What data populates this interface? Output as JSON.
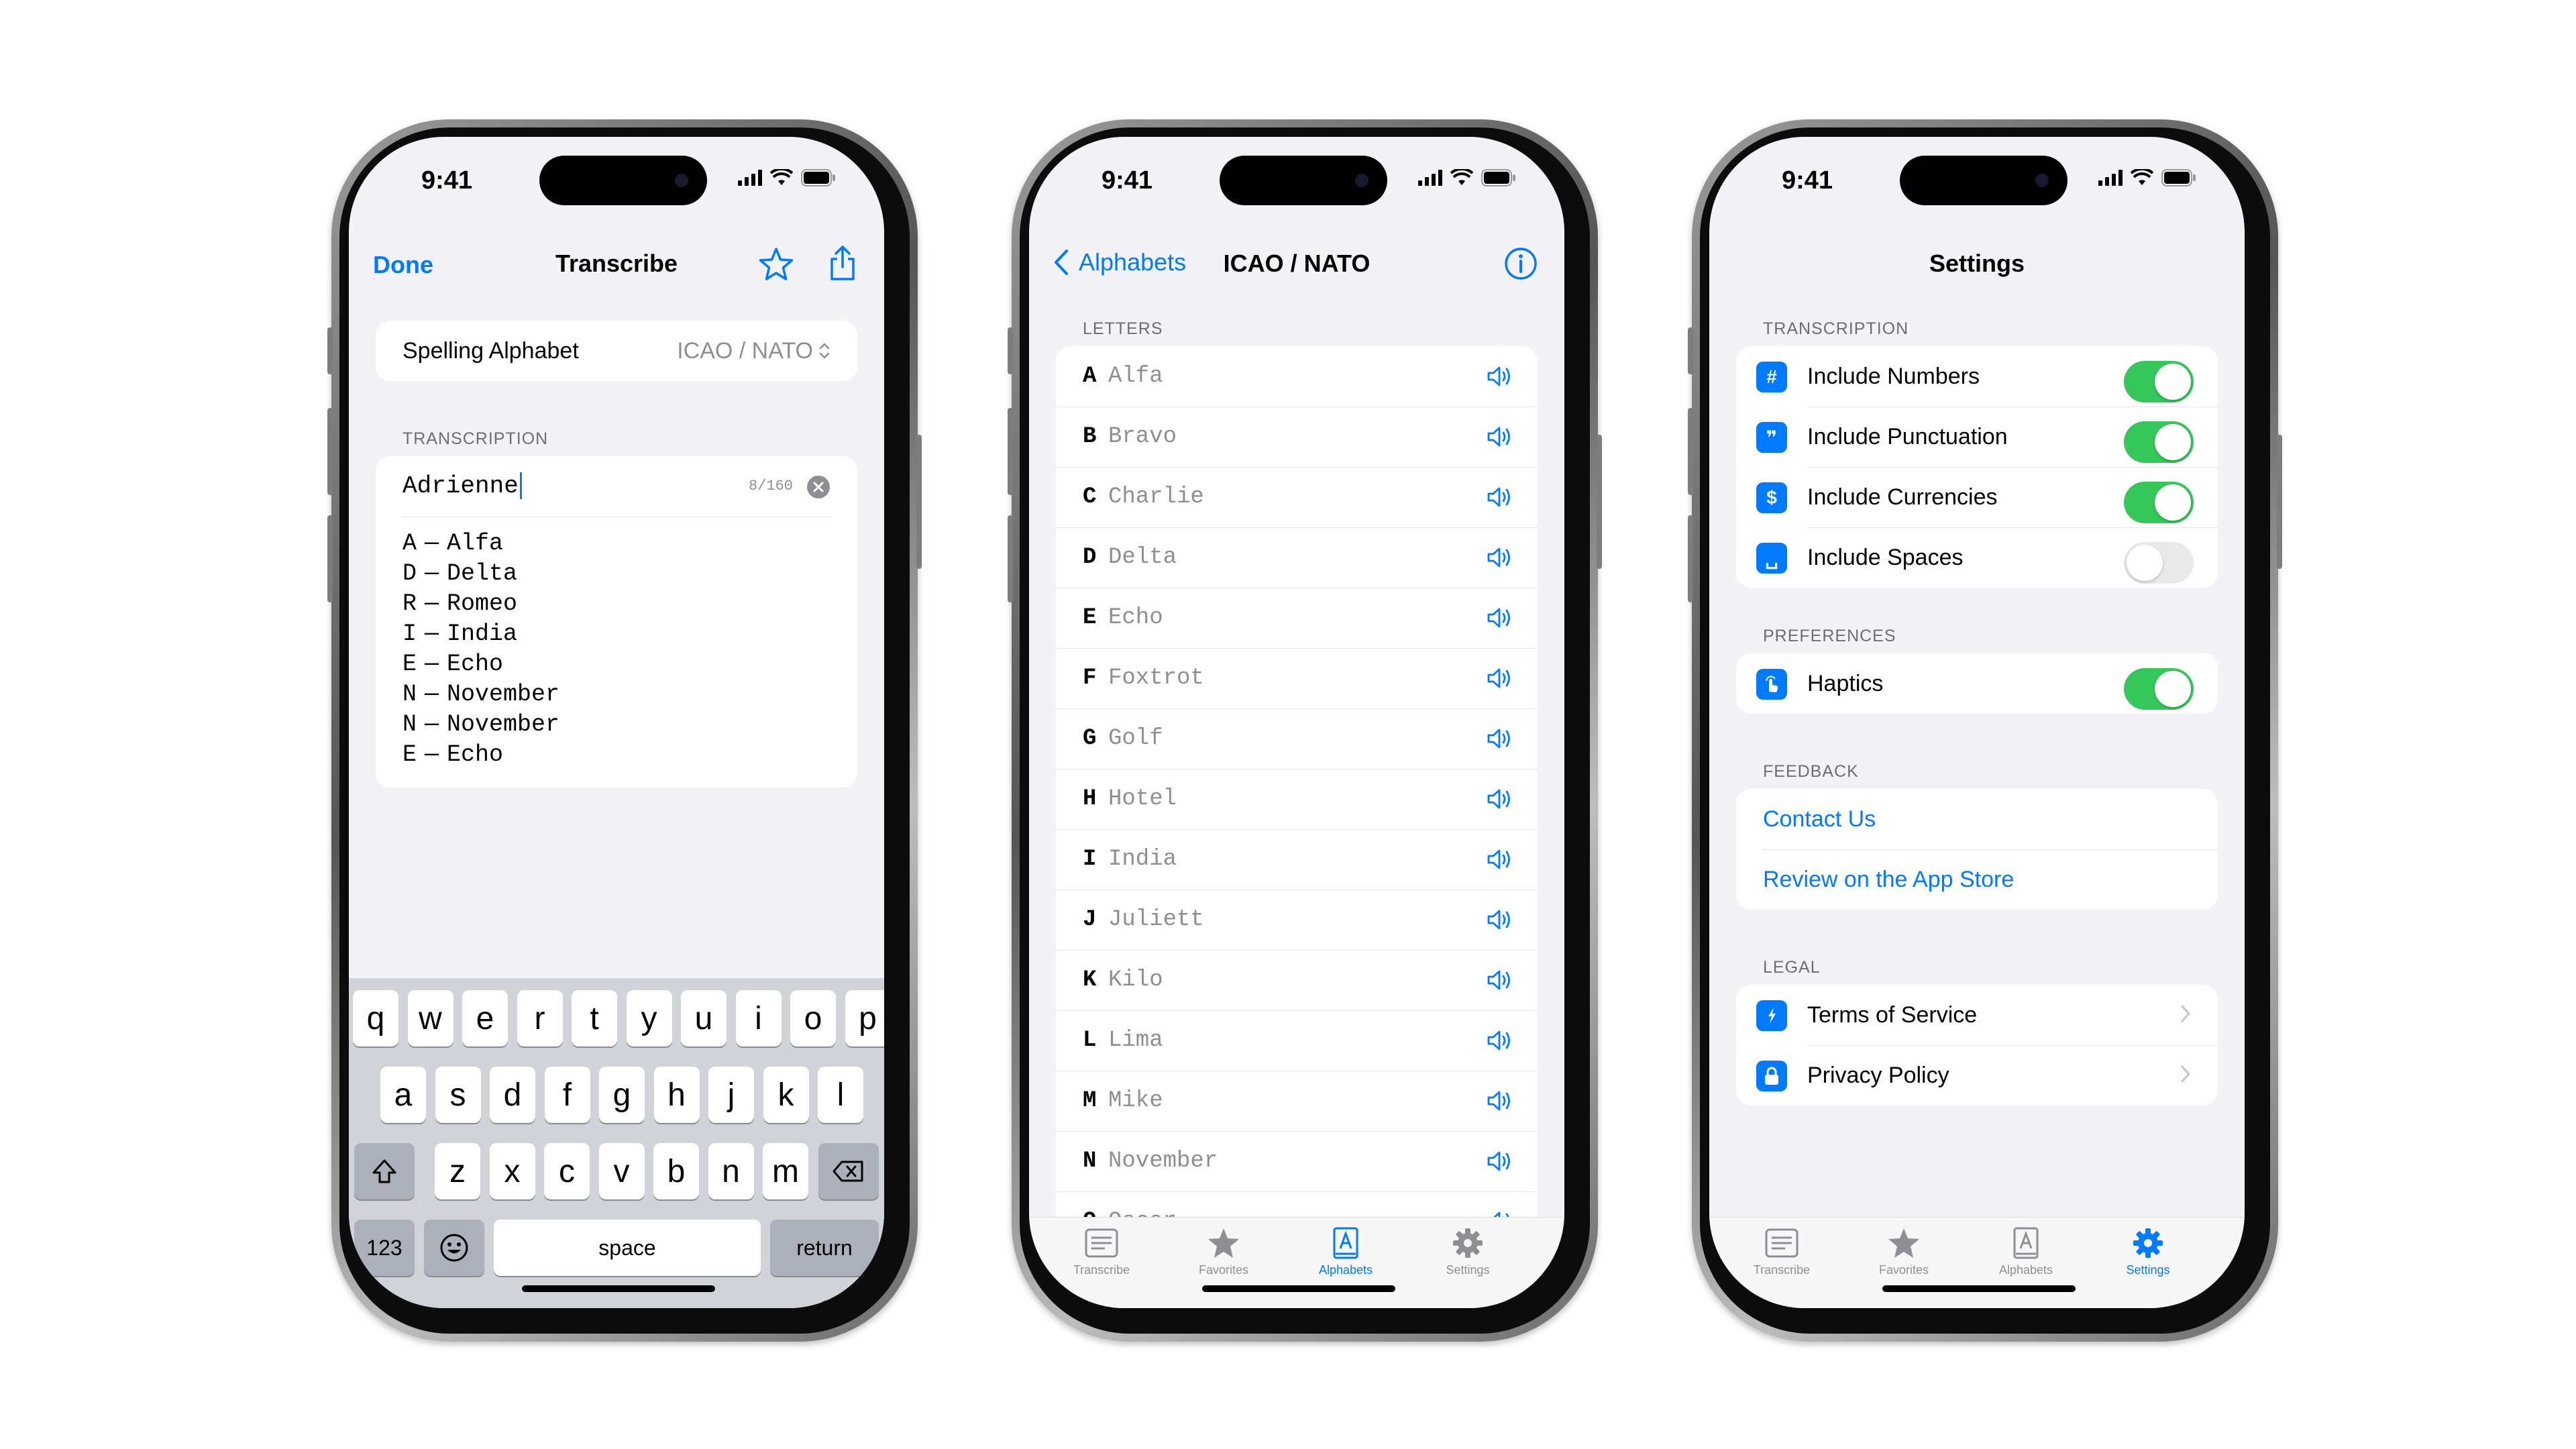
{
  "status": {
    "time": "9:41"
  },
  "transcribe": {
    "nav_left": "Done",
    "title": "Transcribe",
    "alphabet_label": "Spelling Alphabet",
    "alphabet_value": "ICAO / NATO",
    "section": "TRANSCRIPTION",
    "input_value": "Adrienne",
    "counter": "8/160",
    "lines": [
      {
        "l": "A",
        "w": "Alfa"
      },
      {
        "l": "D",
        "w": "Delta"
      },
      {
        "l": "R",
        "w": "Romeo"
      },
      {
        "l": "I",
        "w": "India"
      },
      {
        "l": "E",
        "w": "Echo"
      },
      {
        "l": "N",
        "w": "November"
      },
      {
        "l": "N",
        "w": "November"
      },
      {
        "l": "E",
        "w": "Echo"
      }
    ],
    "separator": "—"
  },
  "keyboard": {
    "row1": [
      "q",
      "w",
      "e",
      "r",
      "t",
      "y",
      "u",
      "i",
      "o",
      "p"
    ],
    "row2": [
      "a",
      "s",
      "d",
      "f",
      "g",
      "h",
      "j",
      "k",
      "l"
    ],
    "row3": [
      "z",
      "x",
      "c",
      "v",
      "b",
      "n",
      "m"
    ],
    "num_label": "123",
    "space_label": "space",
    "return_label": "return"
  },
  "alphabet": {
    "back_label": "Alphabets",
    "title": "ICAO / NATO",
    "section": "LETTERS",
    "letters": [
      {
        "l": "A",
        "w": "Alfa"
      },
      {
        "l": "B",
        "w": "Bravo"
      },
      {
        "l": "C",
        "w": "Charlie"
      },
      {
        "l": "D",
        "w": "Delta"
      },
      {
        "l": "E",
        "w": "Echo"
      },
      {
        "l": "F",
        "w": "Foxtrot"
      },
      {
        "l": "G",
        "w": "Golf"
      },
      {
        "l": "H",
        "w": "Hotel"
      },
      {
        "l": "I",
        "w": "India"
      },
      {
        "l": "J",
        "w": "Juliett"
      },
      {
        "l": "K",
        "w": "Kilo"
      },
      {
        "l": "L",
        "w": "Lima"
      },
      {
        "l": "M",
        "w": "Mike"
      },
      {
        "l": "N",
        "w": "November"
      },
      {
        "l": "O",
        "w": "Oscar"
      }
    ]
  },
  "tabs": [
    "Transcribe",
    "Favorites",
    "Alphabets",
    "Settings"
  ],
  "settings": {
    "title": "Settings",
    "section_transcription": "TRANSCRIPTION",
    "transcription_items": [
      {
        "label": "Include Numbers",
        "icon": "#",
        "on": true
      },
      {
        "label": "Include Punctuation",
        "icon": "❞",
        "on": true
      },
      {
        "label": "Include Currencies",
        "icon": "$",
        "on": true
      },
      {
        "label": "Include Spaces",
        "icon": "␣",
        "on": false
      }
    ],
    "section_preferences": "PREFERENCES",
    "haptics_label": "Haptics",
    "section_feedback": "FEEDBACK",
    "contact_label": "Contact Us",
    "review_label": "Review on the App Store",
    "section_legal": "LEGAL",
    "terms_label": "Terms of Service",
    "privacy_label": "Privacy Policy"
  },
  "colors": {
    "accent": "#007aff",
    "toggle_on": "#34c759",
    "background": "#f2f2f7"
  }
}
